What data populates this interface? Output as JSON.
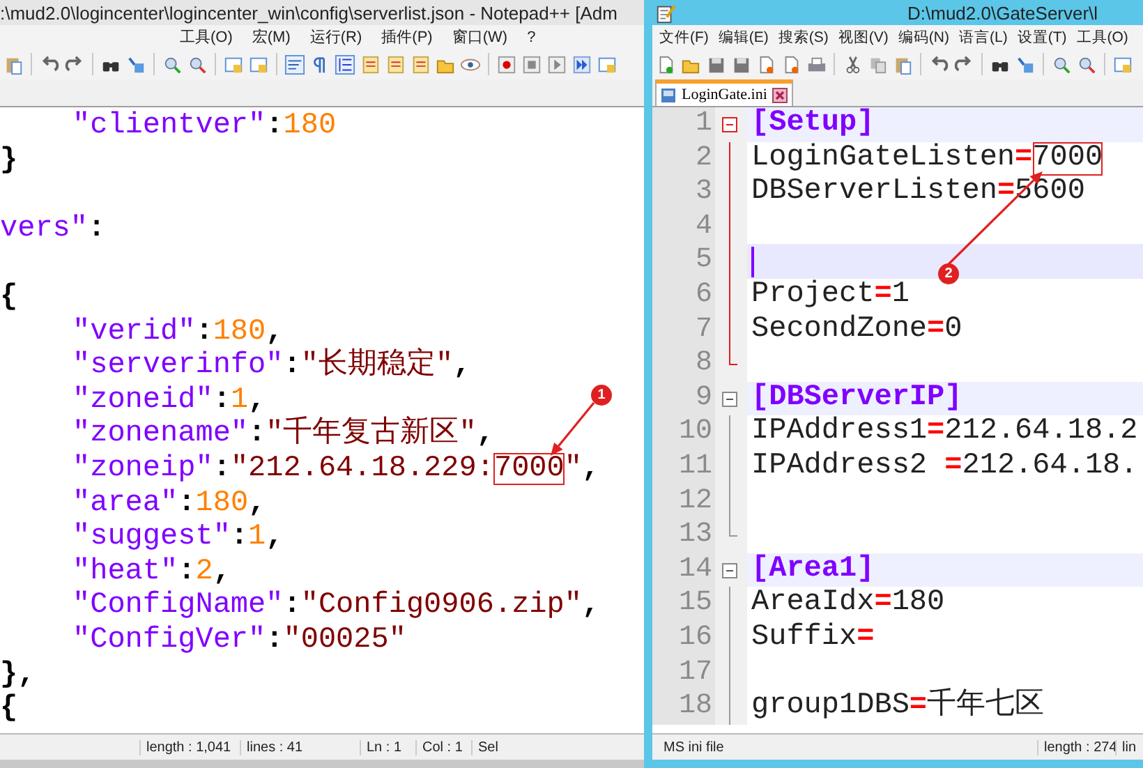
{
  "left_window": {
    "title": ":\\mud2.0\\logincenter\\logincenter_win\\config\\serverlist.json - Notepad++ [Adm",
    "menu": [
      "工具(O)",
      "宏(M)",
      "运行(R)",
      "插件(P)",
      "窗口(W)",
      "?"
    ],
    "editor": {
      "lines": [
        {
          "kind": "inner",
          "tokens": [
            {
              "kind": "key",
              "text": "\"clientver\""
            },
            {
              "kind": "punct",
              "text": ":"
            },
            {
              "kind": "number",
              "text": "180"
            }
          ]
        },
        {
          "kind": "outer",
          "tokens": [
            {
              "kind": "punct",
              "text": "}"
            }
          ]
        },
        {
          "kind": "blank"
        },
        {
          "kind": "outer",
          "tokens": [
            {
              "kind": "key",
              "text": "vers\""
            },
            {
              "kind": "punct",
              "text": ":"
            }
          ]
        },
        {
          "kind": "blank"
        },
        {
          "kind": "outer",
          "tokens": [
            {
              "kind": "punct",
              "text": "{"
            }
          ]
        },
        {
          "kind": "inner",
          "tokens": [
            {
              "kind": "key",
              "text": "\"verid\""
            },
            {
              "kind": "punct",
              "text": ":"
            },
            {
              "kind": "number",
              "text": "180"
            },
            {
              "kind": "punct",
              "text": ","
            }
          ]
        },
        {
          "kind": "inner",
          "tokens": [
            {
              "kind": "key",
              "text": "\"serverinfo\""
            },
            {
              "kind": "punct",
              "text": ":"
            },
            {
              "kind": "string",
              "text": "\"长期稳定\""
            },
            {
              "kind": "punct",
              "text": ","
            }
          ]
        },
        {
          "kind": "inner",
          "tokens": [
            {
              "kind": "key",
              "text": "\"zoneid\""
            },
            {
              "kind": "punct",
              "text": ":"
            },
            {
              "kind": "number",
              "text": "1"
            },
            {
              "kind": "punct",
              "text": ","
            }
          ]
        },
        {
          "kind": "inner",
          "tokens": [
            {
              "kind": "key",
              "text": "\"zonename\""
            },
            {
              "kind": "punct",
              "text": ":"
            },
            {
              "kind": "string",
              "text": "\"千年复古新区\""
            },
            {
              "kind": "punct",
              "text": ","
            }
          ]
        },
        {
          "kind": "inner",
          "tokens": [
            {
              "kind": "key",
              "text": "\"zoneip\""
            },
            {
              "kind": "punct",
              "text": ":"
            },
            {
              "kind": "string",
              "text": "\"212.64.18.229:"
            },
            {
              "kind": "boxed",
              "text": "7000"
            },
            {
              "kind": "string",
              "text": "\""
            },
            {
              "kind": "punct",
              "text": ","
            }
          ]
        },
        {
          "kind": "inner",
          "tokens": [
            {
              "kind": "key",
              "text": "\"area\""
            },
            {
              "kind": "punct",
              "text": ":"
            },
            {
              "kind": "number",
              "text": "180"
            },
            {
              "kind": "punct",
              "text": ","
            }
          ]
        },
        {
          "kind": "inner",
          "tokens": [
            {
              "kind": "key",
              "text": "\"suggest\""
            },
            {
              "kind": "punct",
              "text": ":"
            },
            {
              "kind": "number",
              "text": "1"
            },
            {
              "kind": "punct",
              "text": ","
            }
          ]
        },
        {
          "kind": "inner",
          "tokens": [
            {
              "kind": "key",
              "text": "\"heat\""
            },
            {
              "kind": "punct",
              "text": ":"
            },
            {
              "kind": "number",
              "text": "2"
            },
            {
              "kind": "punct",
              "text": ","
            }
          ]
        },
        {
          "kind": "inner",
          "tokens": [
            {
              "kind": "key",
              "text": "\"ConfigName\""
            },
            {
              "kind": "punct",
              "text": ":"
            },
            {
              "kind": "string",
              "text": "\"Config0906.zip\""
            },
            {
              "kind": "punct",
              "text": ","
            }
          ]
        },
        {
          "kind": "inner",
          "tokens": [
            {
              "kind": "key",
              "text": "\"ConfigVer\""
            },
            {
              "kind": "punct",
              "text": ":"
            },
            {
              "kind": "string",
              "text": "\"00025\""
            }
          ]
        },
        {
          "kind": "outer",
          "tokens": [
            {
              "kind": "punct",
              "text": "},"
            }
          ]
        },
        {
          "kind": "outer",
          "tokens": [
            {
              "kind": "punct",
              "text": "{"
            }
          ]
        }
      ],
      "callout": "1"
    },
    "status_bar": [
      "length : 1,041",
      "lines : 41",
      "Ln : 1",
      "Col : 1",
      "Sel"
    ]
  },
  "right_window": {
    "title": "D:\\mud2.0\\GateServer\\l",
    "menu": [
      "文件(F)",
      "编辑(E)",
      "搜索(S)",
      "视图(V)",
      "编码(N)",
      "语言(L)",
      "设置(T)",
      "工具(O)"
    ],
    "tabs": [
      {
        "label": "LoginGate.ini",
        "selected": true
      }
    ],
    "editor": {
      "lines": [
        {
          "number": "1",
          "kind": "start",
          "current": false,
          "tokens": [
            {
              "kind": "section",
              "text": "[Setup]"
            }
          ]
        },
        {
          "number": "2",
          "kind": "line",
          "current": false,
          "tokens": [
            {
              "kind": "key",
              "text": "LoginGateListen"
            },
            {
              "kind": "eq",
              "text": "="
            },
            {
              "kind": "boxed",
              "text": "7000"
            }
          ]
        },
        {
          "number": "3",
          "kind": "line",
          "current": false,
          "tokens": [
            {
              "kind": "key",
              "text": "DBServerListen"
            },
            {
              "kind": "eq",
              "text": "="
            },
            {
              "kind": "value",
              "text": "5600"
            }
          ]
        },
        {
          "number": "4",
          "kind": "line",
          "current": false
        },
        {
          "number": "5",
          "kind": "line",
          "current": true
        },
        {
          "number": "6",
          "kind": "line",
          "current": false,
          "tokens": [
            {
              "kind": "key",
              "text": "Project"
            },
            {
              "kind": "eq",
              "text": "="
            },
            {
              "kind": "value",
              "text": "1"
            }
          ]
        },
        {
          "number": "7",
          "kind": "line",
          "current": false,
          "tokens": [
            {
              "kind": "key",
              "text": "SecondZone"
            },
            {
              "kind": "eq",
              "text": "="
            },
            {
              "kind": "value",
              "text": "0"
            }
          ]
        },
        {
          "number": "8",
          "kind": "end",
          "current": false
        },
        {
          "number": "9",
          "kind": "start",
          "current": false,
          "tokens": [
            {
              "kind": "section",
              "text": "[DBServerIP]"
            }
          ]
        },
        {
          "number": "10",
          "kind": "line",
          "current": false,
          "tokens": [
            {
              "kind": "key",
              "text": "IPAddress1"
            },
            {
              "kind": "eq",
              "text": "="
            },
            {
              "kind": "value",
              "text": "212.64.18.2"
            }
          ]
        },
        {
          "number": "11",
          "kind": "line",
          "current": false,
          "tokens": [
            {
              "kind": "key",
              "text": "IPAddress2 "
            },
            {
              "kind": "eq",
              "text": "="
            },
            {
              "kind": "value",
              "text": "212.64.18."
            }
          ]
        },
        {
          "number": "12",
          "kind": "line",
          "current": false
        },
        {
          "number": "13",
          "kind": "end",
          "current": false
        },
        {
          "number": "14",
          "kind": "start",
          "current": false,
          "tokens": [
            {
              "kind": "section",
              "text": "[Area1]"
            }
          ]
        },
        {
          "number": "15",
          "kind": "line",
          "current": false,
          "tokens": [
            {
              "kind": "key",
              "text": "AreaIdx"
            },
            {
              "kind": "eq",
              "text": "="
            },
            {
              "kind": "value",
              "text": "180"
            }
          ]
        },
        {
          "number": "16",
          "kind": "line",
          "current": false,
          "tokens": [
            {
              "kind": "key",
              "text": "Suffix"
            },
            {
              "kind": "eq",
              "text": "="
            }
          ]
        },
        {
          "number": "17",
          "kind": "line",
          "current": false
        },
        {
          "number": "18",
          "kind": "line",
          "current": false,
          "tokens": [
            {
              "kind": "key",
              "text": "group1DBS"
            },
            {
              "kind": "eq",
              "text": "="
            },
            {
              "kind": "value",
              "text": "千年七区"
            }
          ]
        }
      ],
      "callout": "2"
    },
    "status_bar": [
      "MS ini file",
      "length : 274",
      "lin"
    ]
  }
}
